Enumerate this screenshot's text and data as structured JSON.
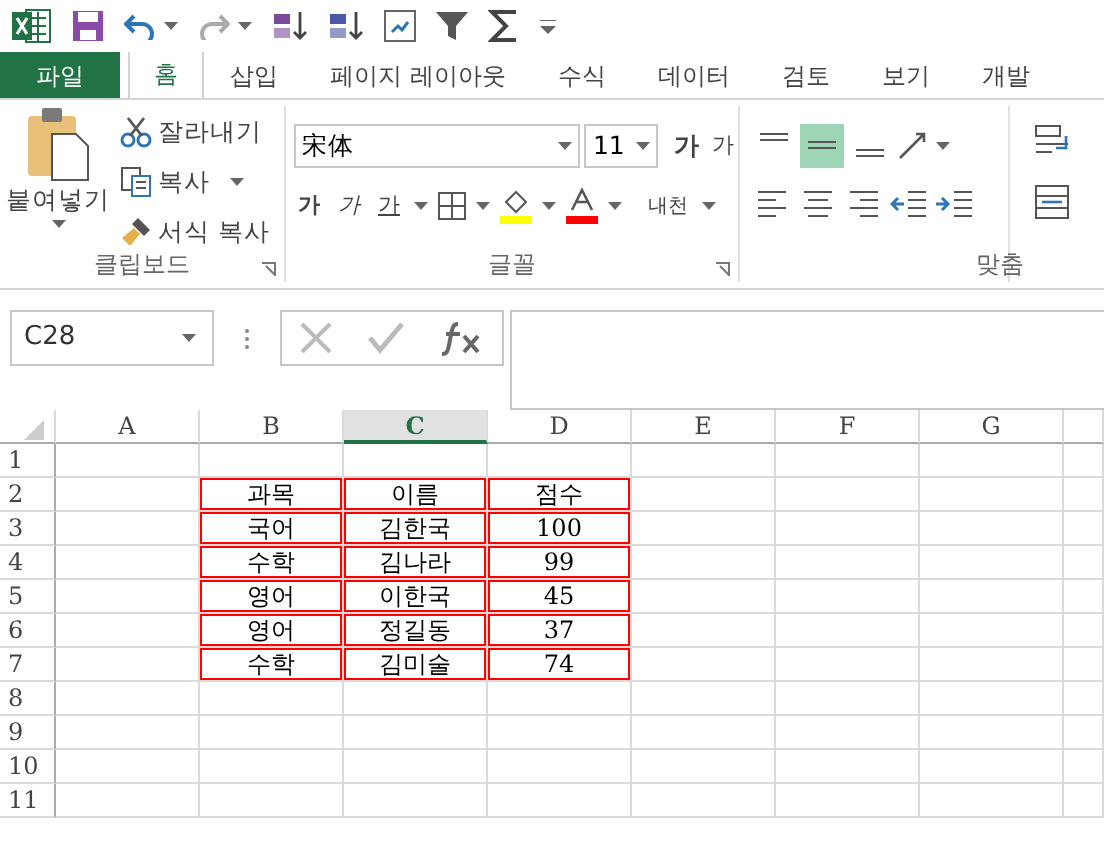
{
  "tabs": [
    {
      "label": "파일",
      "kind": "file",
      "selected": false
    },
    {
      "label": "홈",
      "kind": "tab",
      "selected": true
    },
    {
      "label": "삽입",
      "kind": "tab",
      "selected": false
    },
    {
      "label": "페이지 레이아웃",
      "kind": "tab",
      "selected": false
    },
    {
      "label": "수식",
      "kind": "tab",
      "selected": false
    },
    {
      "label": "데이터",
      "kind": "tab",
      "selected": false
    },
    {
      "label": "검토",
      "kind": "tab",
      "selected": false
    },
    {
      "label": "보기",
      "kind": "tab",
      "selected": false
    },
    {
      "label": "개발",
      "kind": "tab",
      "selected": false
    }
  ],
  "clipboard": {
    "paste": "붙여넣기",
    "cut": "잘라내기",
    "copy": "복사",
    "format_painter": "서식 복사",
    "group_label": "클립보드"
  },
  "font": {
    "name": "宋体",
    "size": "11",
    "grow": "가",
    "shrink": "가",
    "bold": "가",
    "italic": "가",
    "underline": "가",
    "phonetic": "내천",
    "group_label": "글꼴"
  },
  "alignment": {
    "group_label": "맞춤",
    "vertical": [
      {
        "selected": false
      },
      {
        "selected": true
      },
      {
        "selected": false
      }
    ]
  },
  "name_box": "C28",
  "sheet": {
    "columns": [
      {
        "label": "A",
        "selected": false
      },
      {
        "label": "B",
        "selected": false
      },
      {
        "label": "C",
        "selected": true
      },
      {
        "label": "D",
        "selected": false
      },
      {
        "label": "E",
        "selected": false
      },
      {
        "label": "F",
        "selected": false
      },
      {
        "label": "G",
        "selected": false
      }
    ],
    "rows": [
      {
        "label": "1"
      },
      {
        "label": "2",
        "cells": [
          "과목",
          "이름",
          "점수"
        ]
      },
      {
        "label": "3",
        "cells": [
          "국어",
          "김한국",
          "100"
        ]
      },
      {
        "label": "4",
        "cells": [
          "수학",
          "김나라",
          "99"
        ]
      },
      {
        "label": "5",
        "cells": [
          "영어",
          "이한국",
          "45"
        ]
      },
      {
        "label": "6",
        "cells": [
          "영어",
          "정길동",
          "37"
        ]
      },
      {
        "label": "7",
        "cells": [
          "수학",
          "김미술",
          "74"
        ]
      },
      {
        "label": "8"
      },
      {
        "label": "9"
      },
      {
        "label": "10"
      },
      {
        "label": "11"
      }
    ]
  }
}
